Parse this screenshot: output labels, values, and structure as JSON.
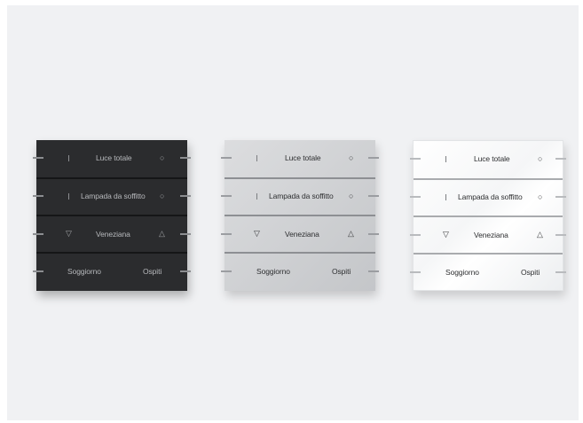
{
  "panels": [
    {
      "finish": "dark",
      "colors": {
        "body": "#2b2c2e",
        "text": "#b7b9bc"
      },
      "rows": [
        {
          "label": "Luce totale",
          "left_icon": "bar-icon",
          "right_icon": "circle-icon"
        },
        {
          "label": "Lampada da soffitto",
          "left_icon": "bar-icon",
          "right_icon": "circle-icon"
        },
        {
          "label": "Veneziana",
          "left_icon": "triangle-down-icon",
          "right_icon": "triangle-up-icon"
        },
        {
          "left_label": "Soggiorno",
          "right_label": "Ospiti"
        }
      ]
    },
    {
      "finish": "silver",
      "colors": {
        "body": "#cfd1d4",
        "text": "#2e2f31"
      },
      "rows": [
        {
          "label": "Luce totale",
          "left_icon": "bar-icon",
          "right_icon": "circle-icon"
        },
        {
          "label": "Lampada da soffitto",
          "left_icon": "bar-icon",
          "right_icon": "circle-icon"
        },
        {
          "label": "Veneziana",
          "left_icon": "triangle-down-icon",
          "right_icon": "triangle-up-icon"
        },
        {
          "left_label": "Soggiorno",
          "right_label": "Ospiti"
        }
      ]
    },
    {
      "finish": "white",
      "colors": {
        "body": "#ffffff",
        "text": "#2e2f31"
      },
      "rows": [
        {
          "label": "Luce totale",
          "left_icon": "bar-icon",
          "right_icon": "circle-icon"
        },
        {
          "label": "Lampada da soffitto",
          "left_icon": "bar-icon",
          "right_icon": "circle-icon"
        },
        {
          "label": "Veneziana",
          "left_icon": "triangle-down-icon",
          "right_icon": "triangle-up-icon"
        },
        {
          "left_label": "Soggiorno",
          "right_label": "Ospiti"
        }
      ]
    }
  ],
  "glyphs": {
    "circle": "○",
    "up": "△",
    "down": "▽"
  }
}
